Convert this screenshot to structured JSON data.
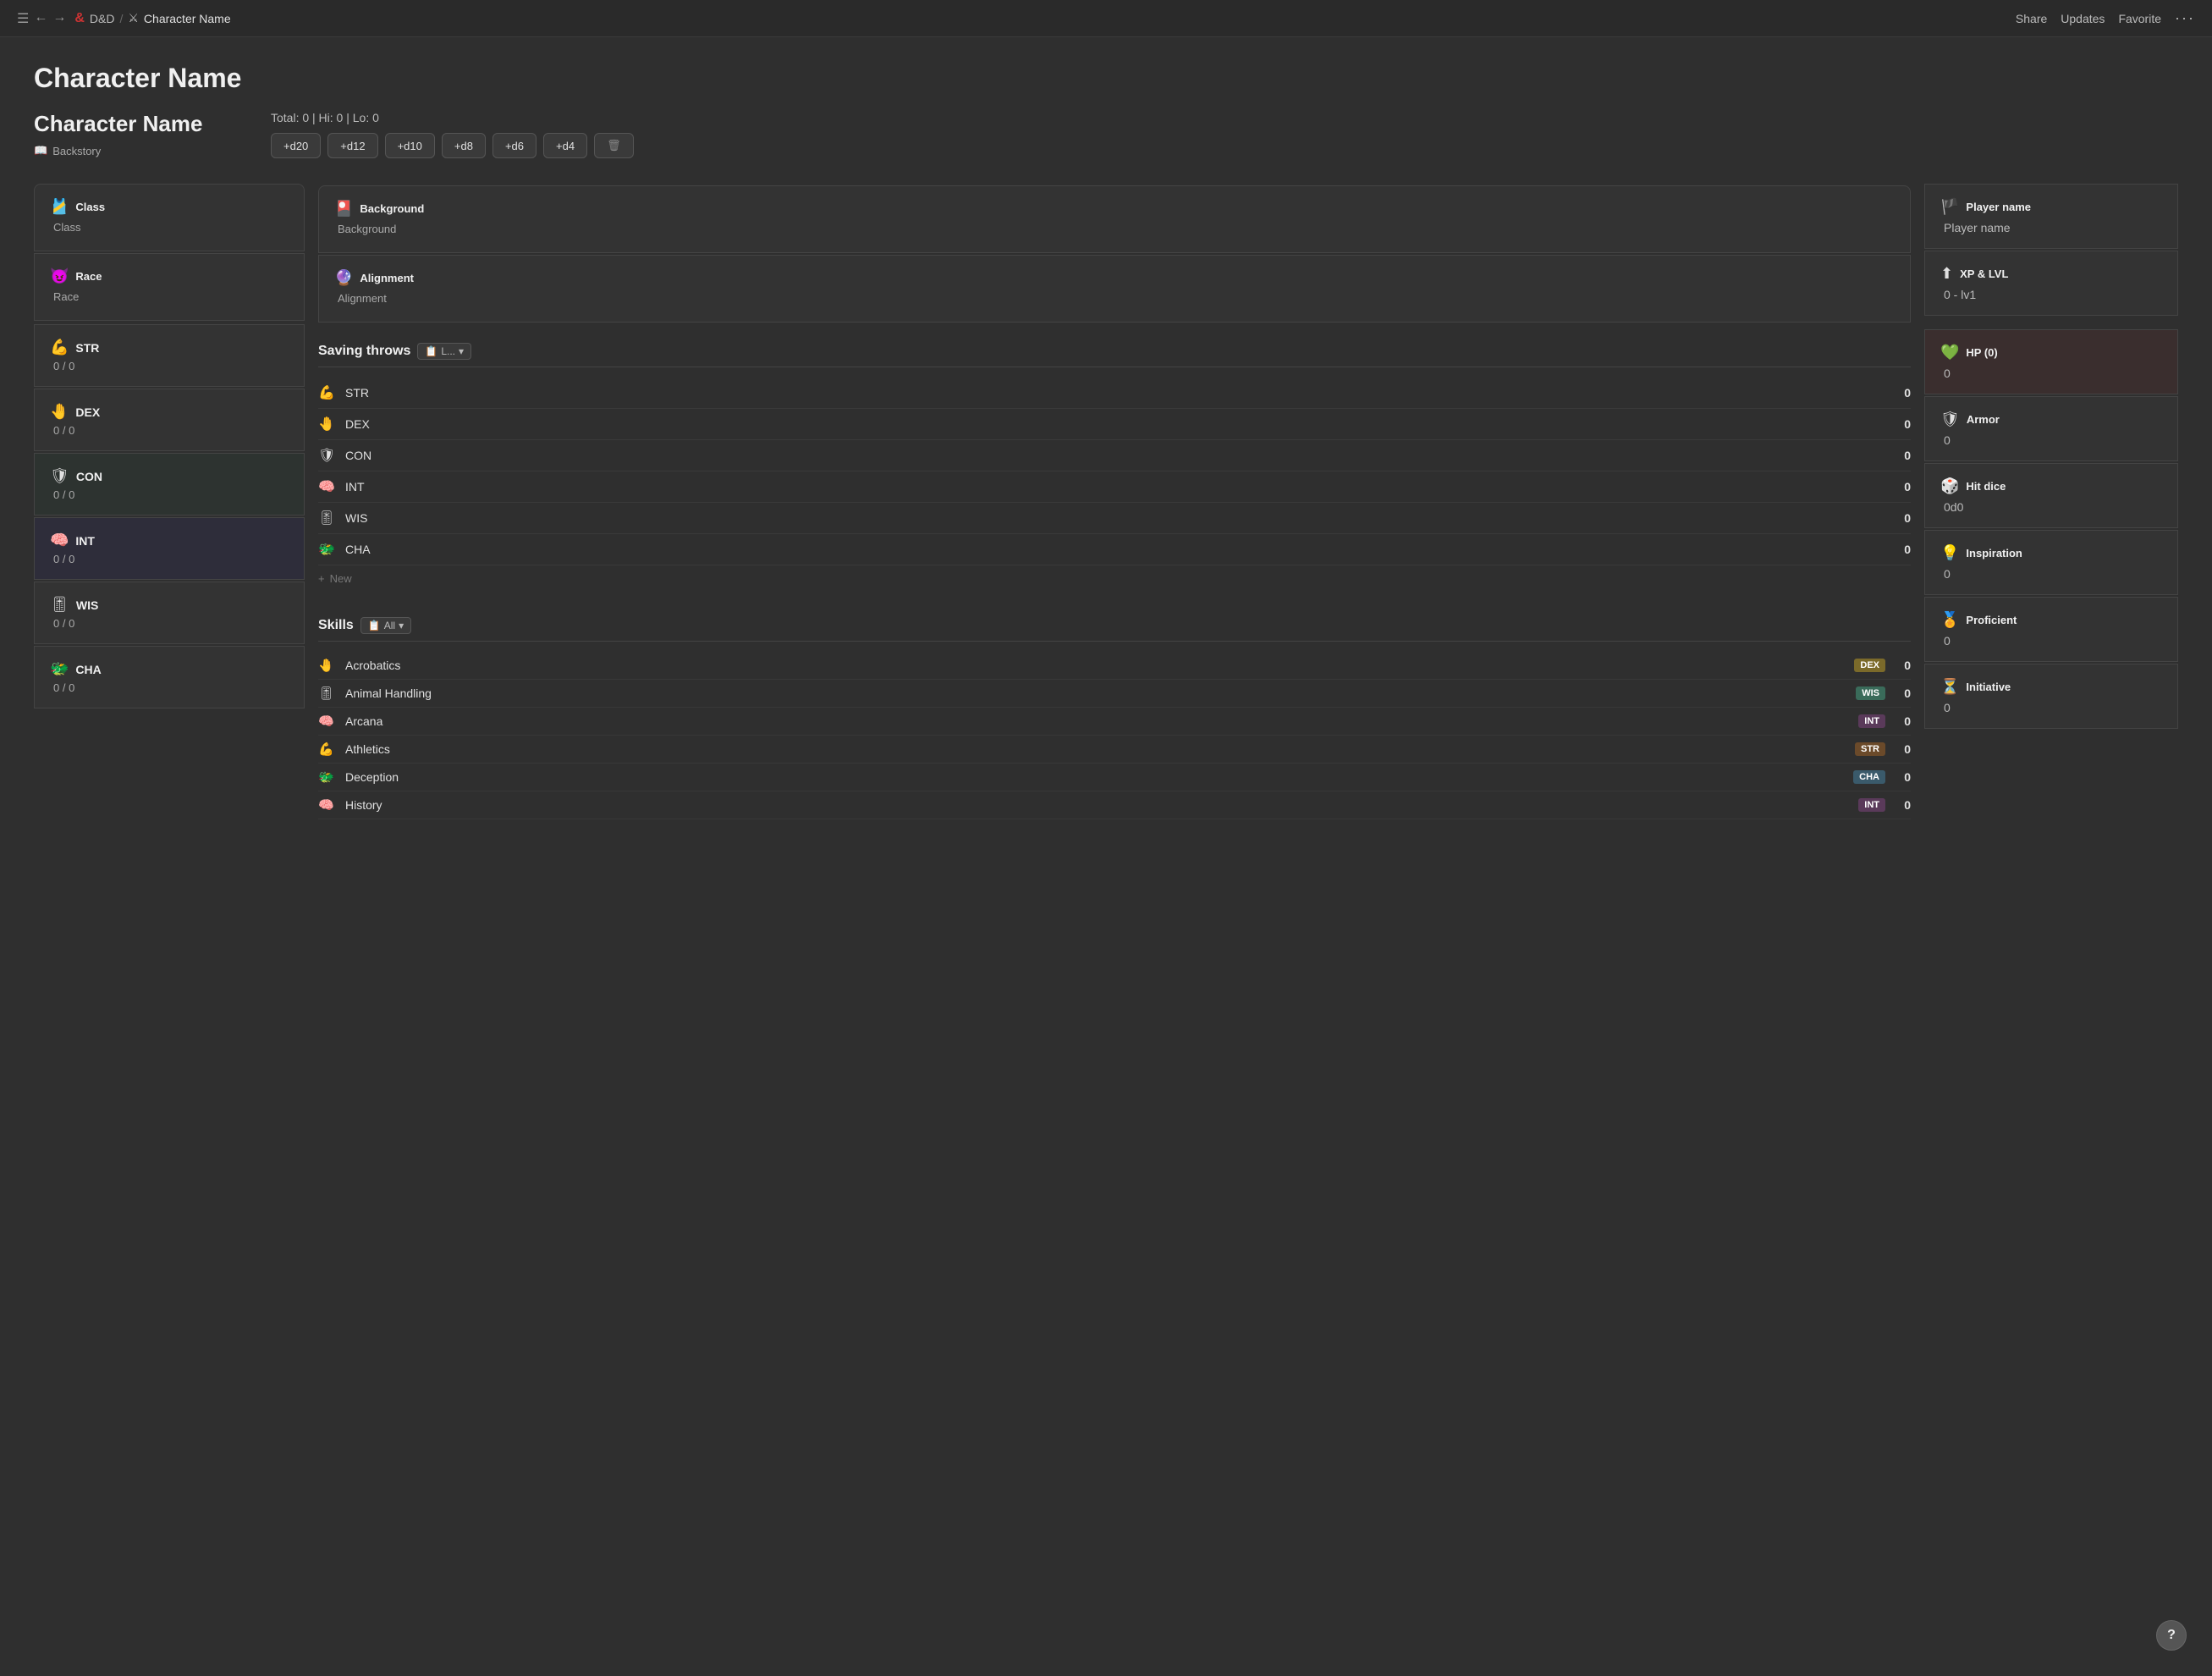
{
  "topbar": {
    "nav_icons": [
      "☰",
      "←",
      "→"
    ],
    "breadcrumb": {
      "app_icon": "&",
      "app_name": "D&D",
      "separator": "/",
      "page_icon": "⚔",
      "page_title": "Character Name"
    },
    "actions": {
      "share": "Share",
      "updates": "Updates",
      "favorite": "Favorite",
      "more": "···"
    }
  },
  "page": {
    "main_title": "Character Name",
    "char_name": "Character Name",
    "backstory_label": "Backstory",
    "dice": {
      "total_label": "Total: 0 | Hi: 0 | Lo: 0",
      "buttons": [
        "+d20",
        "+d12",
        "+d10",
        "+d8",
        "+d6",
        "+d4",
        "🗑"
      ]
    }
  },
  "info_cards_left": [
    {
      "icon": "🎽",
      "title": "Class",
      "value": "Class"
    },
    {
      "icon": "😈",
      "title": "Race",
      "value": "Race"
    }
  ],
  "info_cards_middle": [
    {
      "icon": "🎴",
      "title": "Background",
      "value": "Background"
    },
    {
      "icon": "🔮",
      "title": "Alignment",
      "value": "Alignment"
    }
  ],
  "info_cards_right": [
    {
      "icon": "🏴",
      "title": "Player name",
      "value": "Player name"
    },
    {
      "icon": "⬆",
      "title": "XP & LVL",
      "value": "0 - lv1"
    }
  ],
  "stats": [
    {
      "icon": "💪",
      "name": "STR",
      "value": "0 / 0",
      "highlight": ""
    },
    {
      "icon": "🤚",
      "name": "DEX",
      "value": "0 / 0",
      "highlight": ""
    },
    {
      "icon": "🛡",
      "name": "CON",
      "value": "0 / 0",
      "highlight": "dark-green"
    },
    {
      "icon": "🧠",
      "name": "INT",
      "value": "0 / 0",
      "highlight": "dark-purple"
    },
    {
      "icon": "🎚",
      "name": "WIS",
      "value": "0 / 0",
      "highlight": ""
    },
    {
      "icon": "🐲",
      "name": "CHA",
      "value": "0 / 0",
      "highlight": ""
    }
  ],
  "saving_throws": {
    "title": "Saving throws",
    "filter_label": "L...",
    "items": [
      {
        "icon": "💪",
        "name": "STR",
        "value": "0"
      },
      {
        "icon": "🤚",
        "name": "DEX",
        "value": "0"
      },
      {
        "icon": "🛡",
        "name": "CON",
        "value": "0"
      },
      {
        "icon": "🧠",
        "name": "INT",
        "value": "0"
      },
      {
        "icon": "🎚",
        "name": "WIS",
        "value": "0"
      },
      {
        "icon": "🐲",
        "name": "CHA",
        "value": "0"
      }
    ],
    "add_new_label": "New"
  },
  "skills": {
    "title": "Skills",
    "filter_label": "All",
    "items": [
      {
        "icon": "🤚",
        "name": "Acrobatics",
        "stat": "DEX",
        "stat_class": "badge-dex",
        "value": "0"
      },
      {
        "icon": "🎚",
        "name": "Animal Handling",
        "stat": "WIS",
        "stat_class": "badge-wis",
        "value": "0"
      },
      {
        "icon": "🧠",
        "name": "Arcana",
        "stat": "INT",
        "stat_class": "badge-int",
        "value": "0"
      },
      {
        "icon": "💪",
        "name": "Athletics",
        "stat": "STR",
        "stat_class": "badge-str",
        "value": "0"
      },
      {
        "icon": "🐲",
        "name": "Deception",
        "stat": "CHA",
        "stat_class": "badge-cha",
        "value": "0"
      },
      {
        "icon": "🧠",
        "name": "History",
        "stat": "INT",
        "stat_class": "badge-int",
        "value": "0"
      }
    ]
  },
  "right_cards": [
    {
      "icon": "💚",
      "title": "HP (0)",
      "value": "0",
      "card_class": "hp-card"
    },
    {
      "icon": "🛡",
      "title": "Armor",
      "value": "0",
      "card_class": ""
    },
    {
      "icon": "🎲",
      "title": "Hit dice",
      "value": "0d0",
      "card_class": ""
    },
    {
      "icon": "💡",
      "title": "Inspiration",
      "value": "0",
      "card_class": ""
    },
    {
      "icon": "🏅",
      "title": "Proficient",
      "value": "0",
      "card_class": ""
    },
    {
      "icon": "⏳",
      "title": "Initiative",
      "value": "0",
      "card_class": ""
    }
  ],
  "help_btn_label": "?"
}
